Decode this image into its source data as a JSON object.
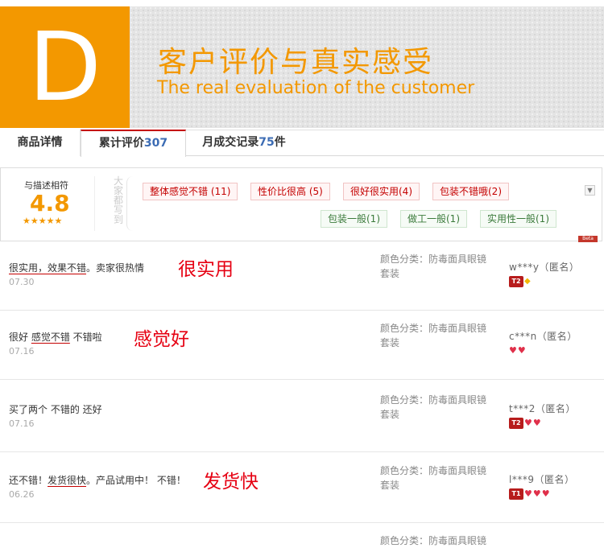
{
  "banner": {
    "letter": "D",
    "title": "客户评价与真实感受",
    "subtitle": "The real evaluation of the customer"
  },
  "tabs": [
    {
      "label": "商品详情",
      "count": ""
    },
    {
      "label": "累计评价",
      "count": "307"
    },
    {
      "label": "月成交记录",
      "count": "75",
      "suffix": "件"
    }
  ],
  "summary": {
    "label": "与描述相符",
    "score": "4.8",
    "stars": "★★★★★",
    "vertical_text": "大家都写到",
    "tags_positive": [
      "整体感觉不错 (11)",
      "性价比很高 (5)",
      "很好很实用(4)",
      "包装不错哦(2)"
    ],
    "tags_neutral": [
      "包装一般(1)",
      "做工一般(1)",
      "实用性一般(1)"
    ],
    "beta": "Beta",
    "collapse_icon": "chevron-down-icon"
  },
  "reviews": [
    {
      "content_parts": [
        "很实用，效果不错",
        "。卖家很热情"
      ],
      "date": "07.30",
      "annotation": "很实用",
      "sku_label": "颜色分类：",
      "sku_value": "防毒面具眼镜套装",
      "user": "w***y（匿名）",
      "level": "T2",
      "badges": "gem"
    },
    {
      "content_parts": [
        "很好 ",
        "感觉不错",
        " 不错啦"
      ],
      "date": "07.16",
      "annotation": "感觉好",
      "sku_label": "颜色分类：",
      "sku_value": "防毒面具眼镜套装",
      "user": "c***n（匿名）",
      "level": "",
      "badges": "hearts2"
    },
    {
      "content_parts": [
        "买了两个 不错的 还好"
      ],
      "date": "07.16",
      "annotation": "",
      "sku_label": "颜色分类：",
      "sku_value": "防毒面具眼镜套装",
      "user": "t***2（匿名）",
      "level": "T2",
      "badges": "hearts2"
    },
    {
      "content_parts": [
        "还不错！",
        "发货很快",
        "。产品试用中！ 不错！"
      ],
      "date": "06.26",
      "annotation": "发货快",
      "sku_label": "颜色分类：",
      "sku_value": "防毒面具眼镜套装",
      "user": "l***9（匿名）",
      "level": "T1",
      "badges": "hearts3"
    },
    {
      "content_parts": [
        ""
      ],
      "date": "",
      "annotation": "",
      "sku_label": "颜色分类：",
      "sku_value": "防毒面具眼镜",
      "user": "",
      "level": "",
      "badges": ""
    }
  ]
}
